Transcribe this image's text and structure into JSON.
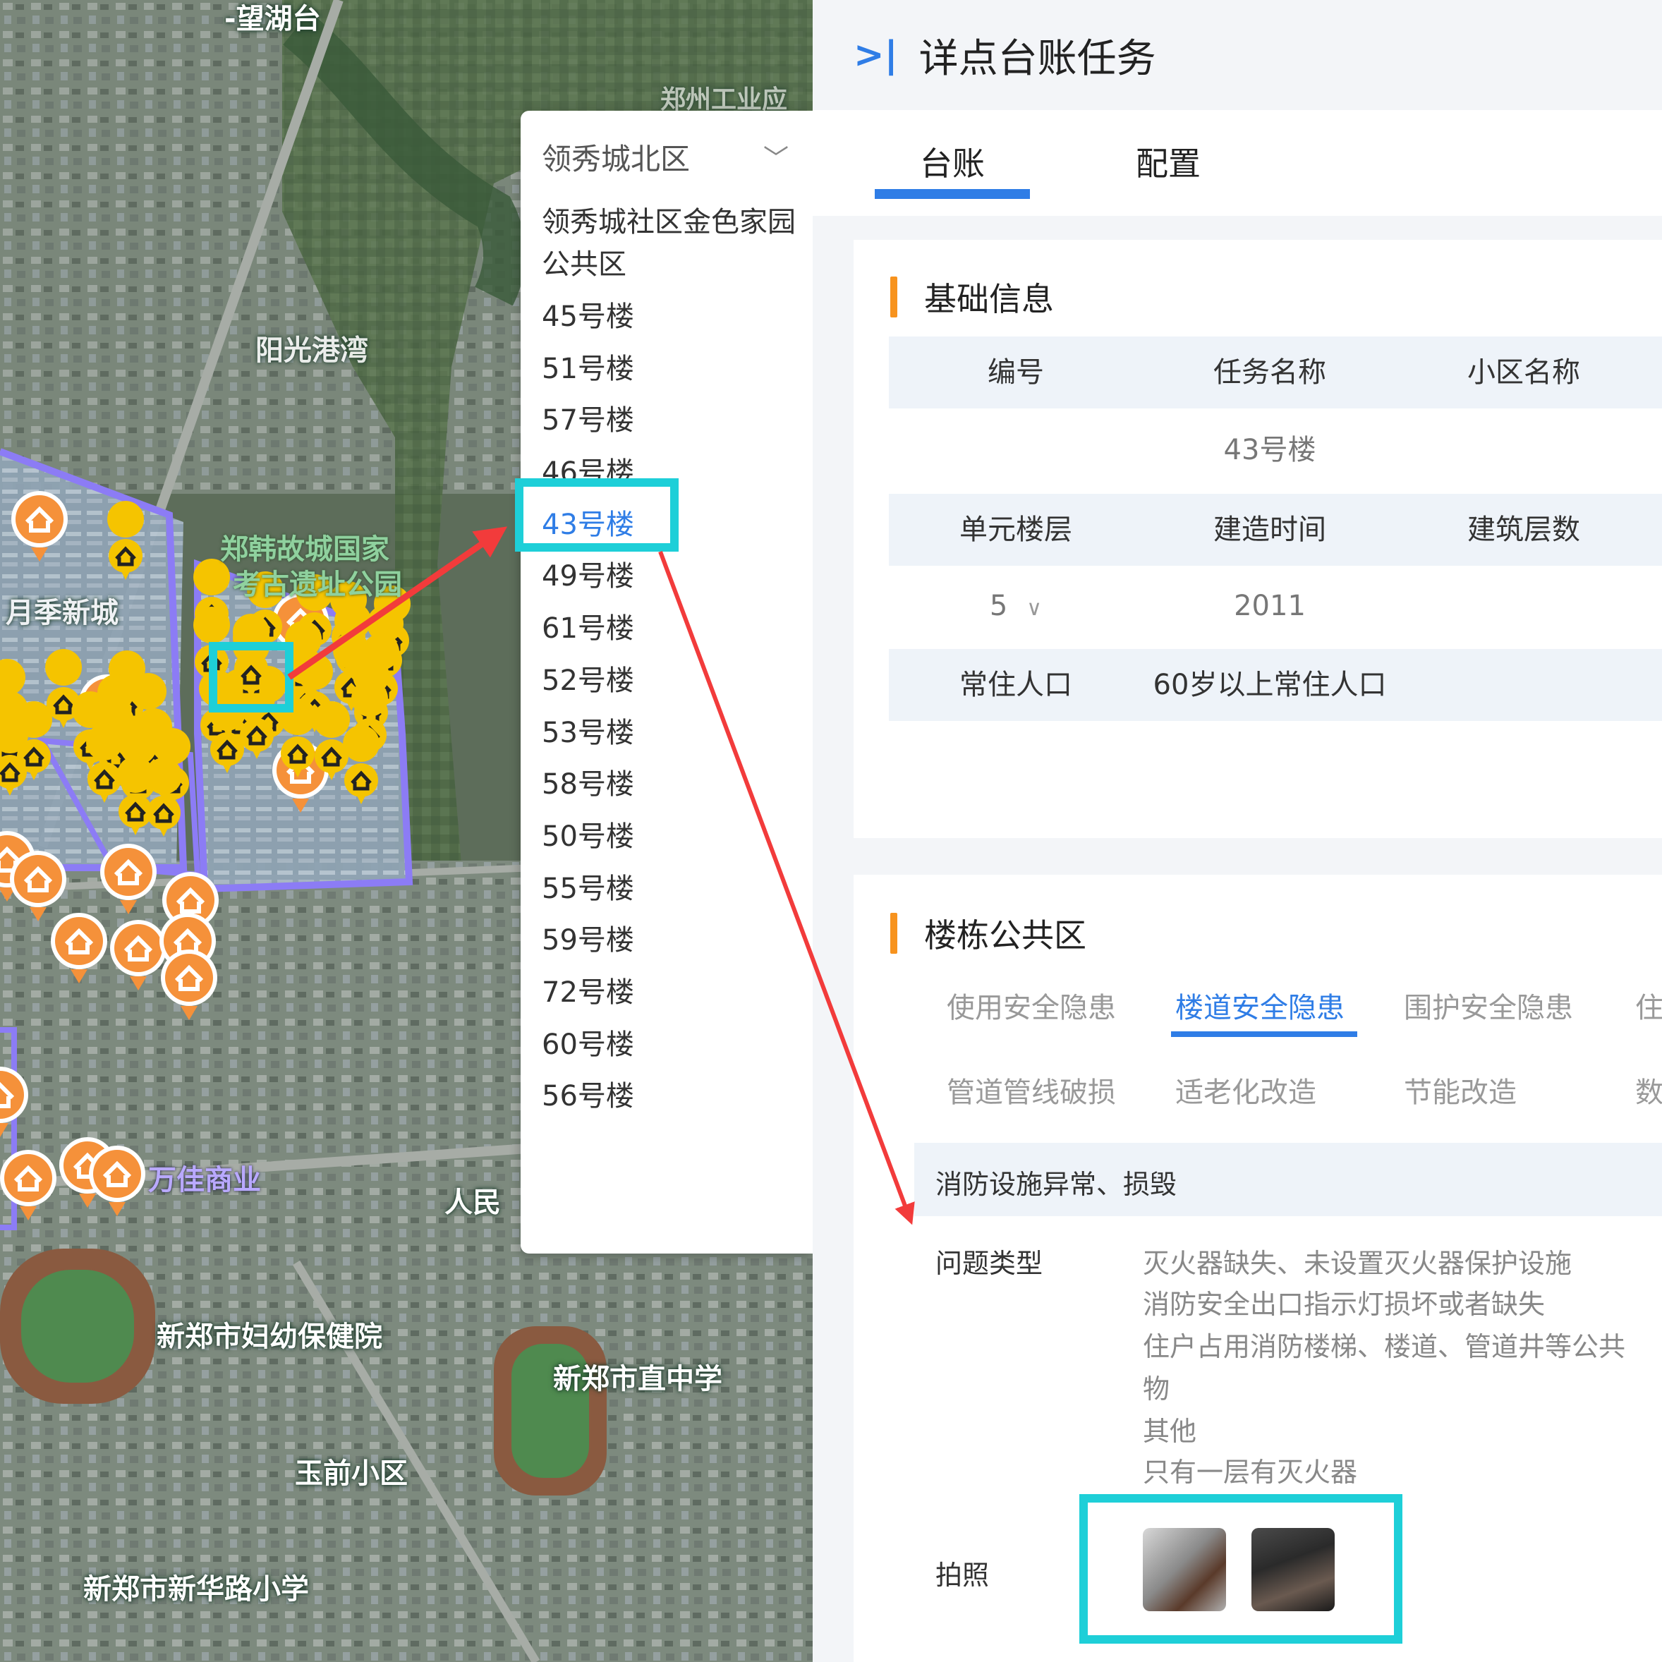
{
  "map": {
    "labels": [
      {
        "id": "wanghutai",
        "text": "-望湖台",
        "style": "normal"
      },
      {
        "id": "zhengzhou",
        "text": "郑州工业应",
        "style": "normal"
      },
      {
        "id": "yangguang",
        "text": "阳光港湾",
        "style": "normal"
      },
      {
        "id": "zhenghan1",
        "text": "郑韩故城国家",
        "style": "green"
      },
      {
        "id": "zhenghan2",
        "text": "考古遗址公园",
        "style": "green"
      },
      {
        "id": "yueji",
        "text": "月季新城",
        "style": "normal"
      },
      {
        "id": "wanjia",
        "text": "万佳商业",
        "style": "purple"
      },
      {
        "id": "renmin",
        "text": "人民",
        "style": "normal"
      },
      {
        "id": "fuyou",
        "text": "新郑市妇幼保健院",
        "style": "normal"
      },
      {
        "id": "zhizhong",
        "text": "新郑市直中学",
        "style": "normal"
      },
      {
        "id": "yuqian",
        "text": "玉前小区",
        "style": "normal"
      },
      {
        "id": "xinhua",
        "text": "新郑市新华路小学",
        "style": "normal"
      }
    ]
  },
  "dropdown": {
    "selected_label": "领秀城北区",
    "items": [
      "领秀城社区金色家园公共区",
      "45号楼",
      "51号楼",
      "57号楼",
      "46号楼",
      "43号楼",
      "49号楼",
      "61号楼",
      "52号楼",
      "53号楼",
      "58号楼",
      "50号楼",
      "55号楼",
      "59号楼",
      "72号楼",
      "60号楼",
      "56号楼"
    ],
    "active_item": "43号楼"
  },
  "panel": {
    "title": "详点台账任务",
    "tabs": [
      "台账",
      "配置"
    ],
    "basic": {
      "title": "基础信息",
      "header1": [
        "编号",
        "任务名称",
        "小区名称"
      ],
      "values1": [
        "",
        "43号楼",
        ""
      ],
      "header2": [
        "单元楼层",
        "建造时间",
        "建筑层数"
      ],
      "floor_value": "5",
      "year_value": "2011",
      "header3": [
        "常住人口",
        "60岁以上常住人口"
      ]
    },
    "building": {
      "title": "楼栋公共区",
      "subtabs_row1": [
        "使用安全隐患",
        "楼道安全隐患",
        "围护安全隐患",
        "住"
      ],
      "subtabs_row2": [
        "管道管线破损",
        "适老化改造",
        "节能改造",
        "数"
      ],
      "active_subtab": "楼道安全隐患",
      "category": "消防设施异常、损毁",
      "issue_label": "问题类型",
      "issues": [
        "灭火器缺失、未设置灭火器保护设施",
        "消防安全出口指示灯损坏或者缺失",
        "住户占用消防楼梯、楼道、管道井等公共",
        "物",
        "其他",
        "只有一层有灭火器"
      ],
      "photo_label": "拍照"
    }
  },
  "colors": {
    "accent": "#2f7de6",
    "orange": "#f7931e",
    "highlight": "#1ecfd8",
    "arrow": "#f23b3b"
  }
}
